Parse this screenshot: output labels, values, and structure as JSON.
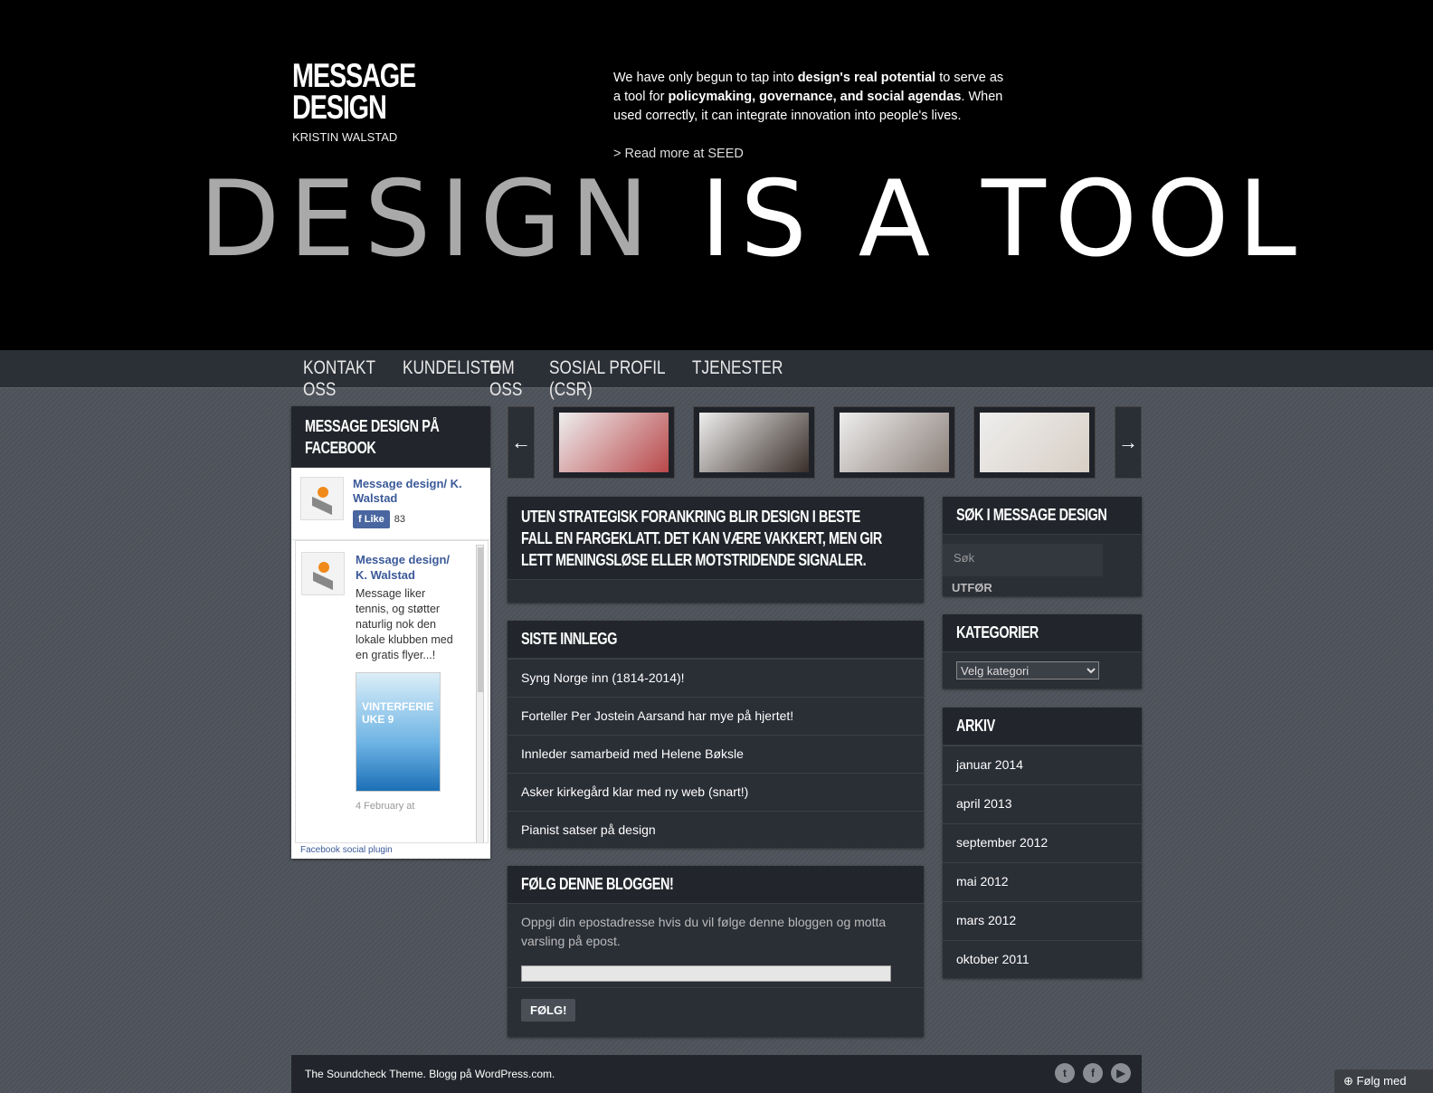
{
  "header": {
    "logo_line1": "MESSAGE",
    "logo_line2": "DESIGN",
    "tagline": "KRISTIN WALSTAD",
    "intro": {
      "p1": "We have only begun to tap into ",
      "b1": "design's real potential",
      "p2": " to serve as a tool for ",
      "b2": "policymaking, governance, and social agendas",
      "p3": ". When used correctly, it can integrate innovation into people's lives.",
      "more": "> Read more at SEED"
    },
    "headline_gray": "DESIGN ",
    "headline_white": "IS A TOOL"
  },
  "nav": {
    "items": [
      "KONTAKT OSS",
      "KUNDELISTE",
      "OM OSS",
      "SOSIAL PROFIL (CSR)",
      "TJENESTER"
    ]
  },
  "facebook": {
    "title": "MESSAGE DESIGN PÅ FACEBOOK",
    "page_name": "Message design/ K. Walstad",
    "like_label": "Like",
    "like_count": "83",
    "post": {
      "author": "Message design/ K. Walstad",
      "message": "Message liker tennis, og støtter naturlig nok den lokale klubben med en gratis flyer...!",
      "flyer_text": "VINTERFERIE UKE 9",
      "date": "4 February at"
    },
    "footer": "Facebook social plugin"
  },
  "carousel": {
    "prev_icon": "arrow-left-icon",
    "next_icon": "arrow-right-icon",
    "thumb_colors": [
      "#b9484a",
      "#3a2f2a",
      "#8b7f78",
      "#d8cfc5"
    ]
  },
  "quote": {
    "text": "UTEN STRATEGISK FORANKRING BLIR DESIGN I BESTE FALL EN FARGEKLATT. DET KAN VÆRE VAKKERT, MEN GIR LETT MENINGSLØSE ELLER MOTSTRIDENDE SIGNALER."
  },
  "recent_posts": {
    "title": "SISTE INNLEGG",
    "items": [
      "Syng Norge inn (1814-2014)!",
      "Forteller Per Jostein Aarsand har mye på hjertet!",
      "Innleder samarbeid med Helene Bøksle",
      "Asker kirkegård klar med ny web (snart!)",
      "Pianist satser på design"
    ]
  },
  "follow": {
    "title": "FØLG DENNE BLOGGEN!",
    "description": "Oppgi din epostadresse hvis du vil følge denne bloggen og motta varsling på epost.",
    "button": "FØLG!"
  },
  "search": {
    "title": "SØK I MESSAGE DESIGN",
    "placeholder": "Søk",
    "button": "UTFØR"
  },
  "categories": {
    "title": "KATEGORIER",
    "selected": "Velg kategori"
  },
  "archive": {
    "title": "ARKIV",
    "items": [
      "januar 2014",
      "april 2013",
      "september 2012",
      "mai 2012",
      "mars 2012",
      "oktober 2011"
    ]
  },
  "footer": {
    "text": "The Soundcheck Theme. Blogg på WordPress.com.",
    "social": [
      "twitter-icon",
      "facebook-icon",
      "youtube-icon"
    ]
  },
  "follow_tab": "Følg med"
}
